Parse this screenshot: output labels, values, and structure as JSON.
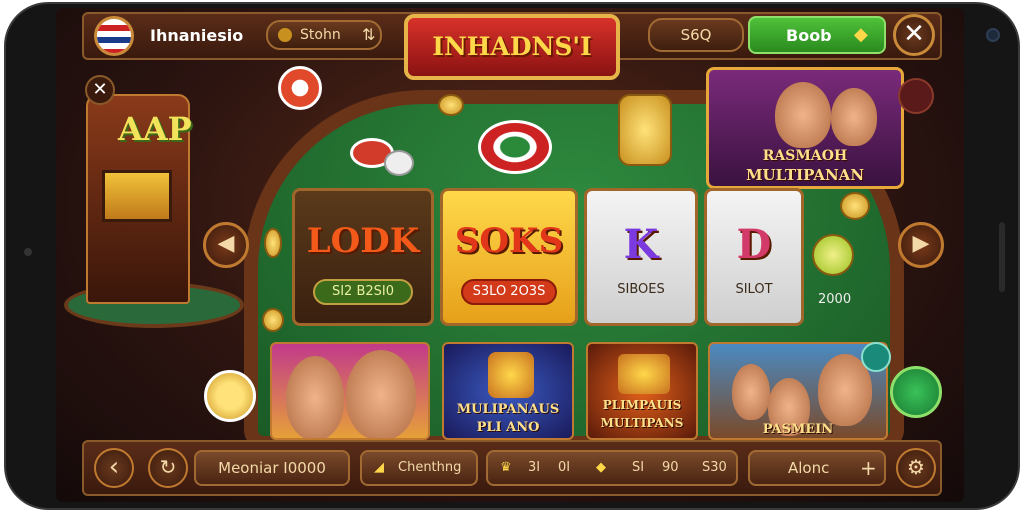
{
  "header": {
    "player_name": "Ihnaniesio",
    "balance_pill": "Stohn",
    "logo_text": "INHADNS'I",
    "coins_pill": "S6Q",
    "green_button": "Boob"
  },
  "decor": {
    "arcade_text": "AAP"
  },
  "promo": {
    "line1": "RASMAOH",
    "line2": "MULTIPANAN"
  },
  "cards": [
    {
      "big": "LODK",
      "sub": "SI2 B2SI0"
    },
    {
      "big": "SOKS",
      "sub": "S3LO 2O3S"
    },
    {
      "big": "K",
      "sub": "SIBOES"
    },
    {
      "big": "D",
      "sub": "SILOT"
    }
  ],
  "coin_value": "2000",
  "games": [
    {
      "title": ""
    },
    {
      "title_line1": "MULIPANAUS",
      "title_line2": "PLI ANO"
    },
    {
      "title_line1": "PLIMPAUIS",
      "title_line2": "MULTIPANS"
    },
    {
      "title": "PASMEIN"
    }
  ],
  "footer": {
    "member_pill": "Meoniar I0000",
    "button_mid": "Chenthng",
    "stat1": "3I",
    "stat2": "0I",
    "stat3": "SI",
    "stat4": "90",
    "stat5": "S30",
    "action_pill": "Alonc"
  },
  "colors": {
    "accent_gold": "#e6b448",
    "table_green": "#2e8a3e",
    "frame_brown": "#6a3418",
    "button_green": "#4fc23a"
  }
}
